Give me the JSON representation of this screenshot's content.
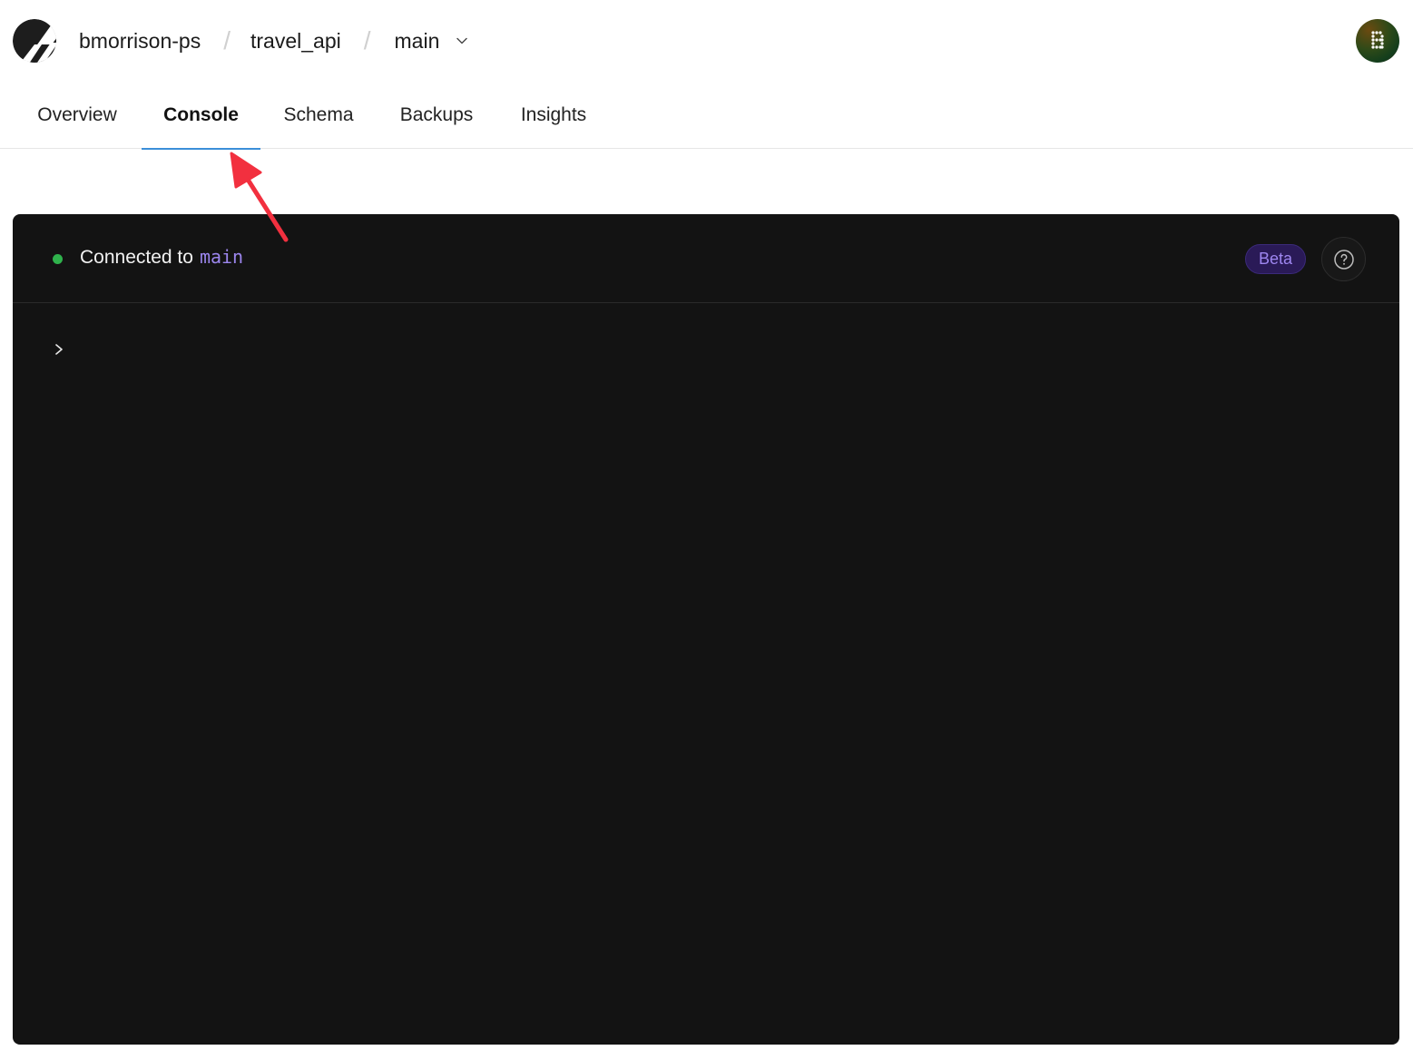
{
  "header": {
    "logo": "planetscale-logo-icon",
    "breadcrumb": {
      "organization": "bmorrison-ps",
      "separator": "/",
      "database": "travel_api",
      "branch": "main",
      "branch_dropdown_icon": "chevron-down-icon"
    },
    "avatar_letter": "B"
  },
  "tabs": [
    {
      "label": "Overview",
      "active": false
    },
    {
      "label": "Console",
      "active": true
    },
    {
      "label": "Schema",
      "active": false
    },
    {
      "label": "Backups",
      "active": false
    },
    {
      "label": "Insights",
      "active": false
    }
  ],
  "console": {
    "status_text": "Connected to",
    "connected_branch": "main",
    "status_color": "#2fb24c",
    "badge": "Beta",
    "help_icon": "question-circle-icon",
    "prompt_symbol": "chevron-right-icon",
    "input_value": ""
  },
  "colors": {
    "tab_active_underline": "#3b8fd9",
    "console_background": "#131313",
    "branch_text": "#9c86ee",
    "annotation_arrow": "#f2303f"
  }
}
